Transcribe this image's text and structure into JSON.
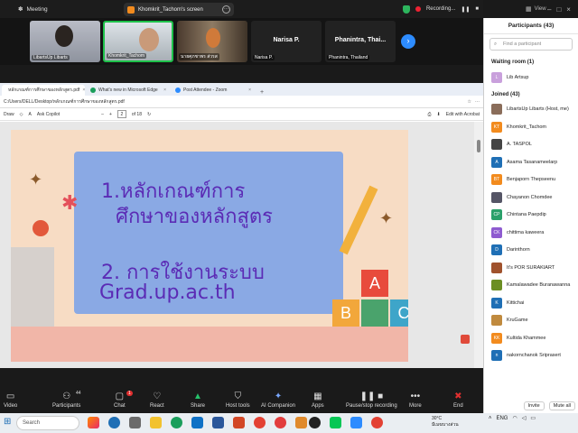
{
  "topbar": {
    "meeting_label": "Meeting",
    "share_label": "Khomkrit_Tachom's screen",
    "recording_label": "Recording...",
    "view_label": "View"
  },
  "participant_strip": {
    "tiles": [
      {
        "name": "LibartsUp Libarts"
      },
      {
        "name": "Khomkrit_Tachom"
      },
      {
        "name": "นายศุภชาพร ส่วรส"
      },
      {
        "name": "Narisa P.",
        "big": "Narisa P."
      },
      {
        "name": "Phanintra, Thailand",
        "big": "Phanintra,  Thai..."
      }
    ]
  },
  "browser": {
    "tabs": [
      {
        "label": "หลักเกณฑ์การศึกษาของหลักสูตร.pdf",
        "color": "#d33"
      },
      {
        "label": "What's new in Microsoft Edge",
        "color": "#1a9e5b"
      },
      {
        "label": "Post Attendee - Zoom",
        "color": "#2d8cff"
      }
    ],
    "new_tab": "+",
    "url": "C:/Users/DELL/Desktop/หลักเกณฑ์การศึกษาของหลักสูตร.pdf",
    "tools": {
      "draw": "Draw",
      "ask_copilot": "Ask Copilot",
      "page_current": "2",
      "page_total": "of 18",
      "edit_acrobat": "Edit with Acrobat",
      "zoom_minus": "–",
      "zoom_plus": "+"
    }
  },
  "slide": {
    "line1": "1.หลักเกณฑ์การ",
    "line2": "ศึกษาของหลักสูตร",
    "line3": "2. การใช้งานระบบ",
    "line4": "Grad.up.ac.th",
    "block_a": "A",
    "block_b": "B",
    "block_c": "C"
  },
  "toolbar": {
    "video": "Video",
    "participants": "Participants",
    "participants_count": "44",
    "chat": "Chat",
    "chat_badge": "1",
    "react": "React",
    "share": "Share",
    "host_tools": "Host tools",
    "ai_companion": "AI Companion",
    "apps": "Apps",
    "pause_stop": "Pause/stop recording",
    "more": "More",
    "end": "End"
  },
  "panel": {
    "title": "Participants (43)",
    "find_placeholder": "Find a participant",
    "waiting_header": "Waiting room (1)",
    "waiting": [
      {
        "initials": "L",
        "name": "Lib Artsup",
        "color": "#c9a0dc"
      }
    ],
    "joined_header": "Joined (43)",
    "joined": [
      {
        "initials": "",
        "name": "LibartsUp Libarts (Host, me)",
        "color": "#8a6d5a"
      },
      {
        "initials": "KT",
        "name": "Khomkrit_Tachom",
        "color": "#f28b1e"
      },
      {
        "initials": "",
        "name": "A. TASPOL",
        "color": "#444"
      },
      {
        "initials": "A",
        "name": "Asama Tasanameelarp",
        "color": "#1f6fb5"
      },
      {
        "initials": "BT",
        "name": "Benjaporn Thepseenu",
        "color": "#f28b1e"
      },
      {
        "initials": "",
        "name": "Chayanon Chomdee",
        "color": "#556"
      },
      {
        "initials": "CP",
        "name": "Chintana Paepdip",
        "color": "#2aa06a"
      },
      {
        "initials": "CK",
        "name": "chittima kaweera",
        "color": "#8e5bd0"
      },
      {
        "initials": "D",
        "name": "Darinthorn",
        "color": "#1f6fb5"
      },
      {
        "initials": "",
        "name": "It's POR SURAKIART",
        "color": "#a0522d"
      },
      {
        "initials": "",
        "name": "Kamalawadee Buranawanna",
        "color": "#6b8e23"
      },
      {
        "initials": "K",
        "name": "Kittichai",
        "color": "#1f6fb5"
      },
      {
        "initials": "",
        "name": "KruGame",
        "color": "#c08a3e"
      },
      {
        "initials": "KK",
        "name": "Kultida Khammee",
        "color": "#f28b1e"
      },
      {
        "initials": "n",
        "name": "nakornchanok Sriprasert",
        "color": "#1f6fb5"
      }
    ],
    "invite": "Invite",
    "mute_all": "Mute all"
  },
  "taskbar": {
    "search": "Search",
    "temp": "30°C",
    "weather_desc": "มีเมฆบางส่วน",
    "lang": "ENG"
  }
}
